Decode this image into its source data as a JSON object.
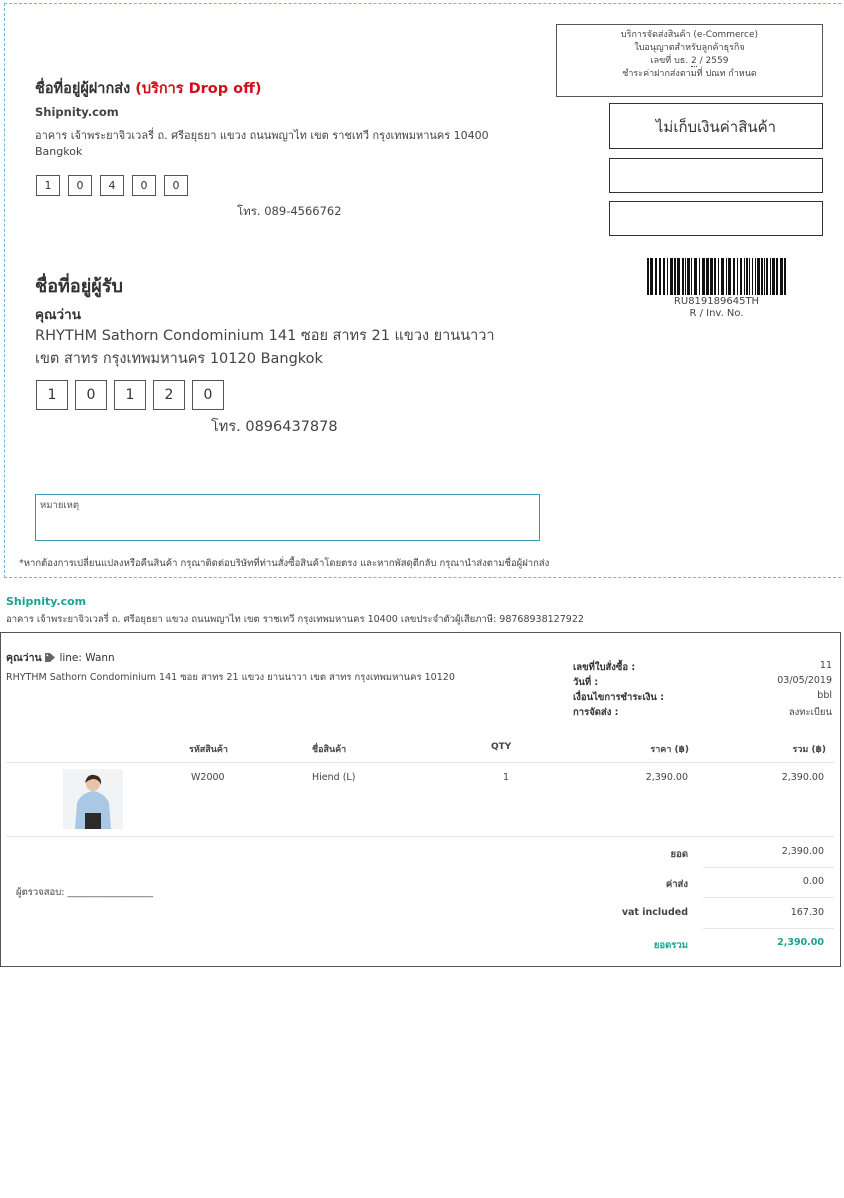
{
  "label": {
    "permit": {
      "line1": "บริการจัดส่งสินค้า (e-Commerce)",
      "line2": "ใบอนุญาตสำหรับลูกค้าธุรกิจ",
      "line3_prefix": "เลขที่ บธ.",
      "line3_number": "2",
      "line3_suffix": "/ 2559",
      "line4": "ชำระค่าฝากส่งตามที่ ปณท กำหนด"
    },
    "cod_text": "ไม่เก็บเงินค่าสินค้า",
    "sender": {
      "title": "ชื่อที่อยู่ผู้ฝากส่ง",
      "service": "(บริการ Drop off)",
      "name": "Shipnity.com",
      "address": "อาคาร เจ้าพระยาจิวเวลรี่ ถ. ศรีอยุธยา แขวง ถนนพญาไท เขต ราชเทวี กรุงเทพมหานคร 10400 Bangkok",
      "zip": [
        "1",
        "0",
        "4",
        "0",
        "0"
      ],
      "phone": "โทร. 089-4566762"
    },
    "receiver": {
      "title": "ชื่อที่อยู่ผู้รับ",
      "name": "คุณว่าน",
      "address_line1": "RHYTHM Sathorn Condominium 141 ซอย สาทร 21 แขวง ยานนาวา",
      "address_line2": "เขต สาทร กรุงเทพมหานคร 10120 Bangkok",
      "zip": [
        "1",
        "0",
        "1",
        "2",
        "0"
      ],
      "phone": "โทร. 0896437878"
    },
    "tracking_number": "RU819189645TH",
    "tracking_caption": "R / Inv. No.",
    "remark_label": "หมายเหตุ",
    "footnote": "*หากต้องการเปลี่ยนแปลงหรือคืนสินค้า กรุณาติดต่อบริษัทที่ท่านสั่งซื้อสินค้าโดยตรง และหากพัสดุตีกลับ กรุณานำส่งตามชื่อผู้ฝากส่ง"
  },
  "shop": {
    "name": "Shipnity.com",
    "address": "อาคาร เจ้าพระยาจิวเวลรี่ ถ. ศรีอยุธยา แขวง ถนนพญาไท เขต ราชเทวี กรุงเทพมหานคร 10400 เลขประจำตัวผู้เสียภาษี: 98768938127922"
  },
  "invoice": {
    "customer_name": "คุณว่าน",
    "tag_icon": "tag-icon",
    "line_id": "line: Wann",
    "customer_address": "RHYTHM Sathorn Condominium 141 ซอย สาทร 21 แขวง ยานนาวา เขต สาทร กรุงเทพมหานคร 10120",
    "meta": [
      {
        "label": "เลขที่ใบสั่งซื้อ :",
        "value": "11"
      },
      {
        "label": "วันที่ :",
        "value": "03/05/2019"
      },
      {
        "label": "เงื่อนไขการชำระเงิน :",
        "value": "bbl"
      },
      {
        "label": "การจัดส่ง :",
        "value": "ลงทะเบียน"
      }
    ],
    "columns": {
      "code": "รหัสสินค้า",
      "name": "ชื่อสินค้า",
      "qty": "QTY",
      "price": "ราคา (฿)",
      "total": "รวม (฿)"
    },
    "items": [
      {
        "code": "W2000",
        "name": "Hiend (L)",
        "qty": "1",
        "price": "2,390.00",
        "total": "2,390.00"
      }
    ],
    "totals": [
      {
        "label": "ยอด",
        "value": "2,390.00"
      },
      {
        "label": "ค่าส่ง",
        "value": "0.00"
      },
      {
        "label": "vat included",
        "value": "167.30"
      },
      {
        "label": "ยอดรวม",
        "value": "2,390.00"
      }
    ],
    "checker": "ผู้ตรวจสอบ: __________________",
    "accent_color": "#1aa394"
  }
}
